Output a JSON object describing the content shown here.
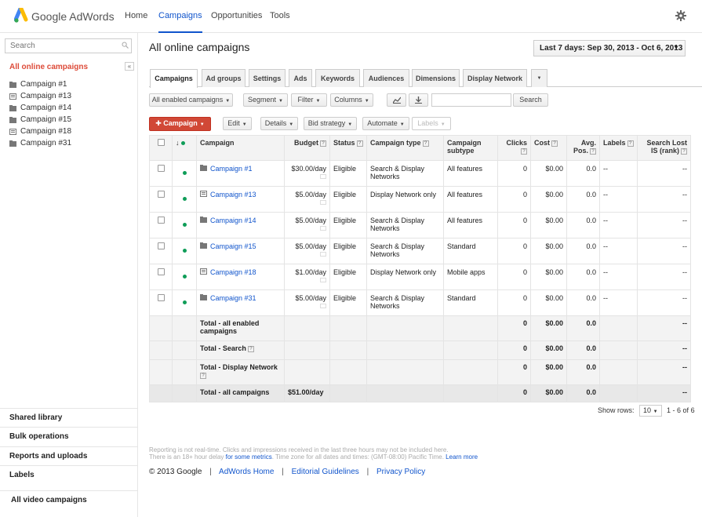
{
  "brand": {
    "name": "Google AdWords"
  },
  "nav": {
    "items": [
      "Home",
      "Campaigns",
      "Opportunities",
      "Tools"
    ],
    "active": "Campaigns"
  },
  "sidebar": {
    "search_placeholder": "Search",
    "collapse_label": "«",
    "all_campaigns_label": "All online campaigns",
    "campaigns": [
      {
        "label": "Campaign #1",
        "icon": "search-campaign-icon"
      },
      {
        "label": "Campaign #13",
        "icon": "display-campaign-icon"
      },
      {
        "label": "Campaign #14",
        "icon": "search-campaign-icon"
      },
      {
        "label": "Campaign #15",
        "icon": "search-campaign-icon"
      },
      {
        "label": "Campaign #18",
        "icon": "display-campaign-icon"
      },
      {
        "label": "Campaign #31",
        "icon": "search-campaign-icon"
      }
    ],
    "sections": [
      "Shared library",
      "Bulk operations",
      "Reports and uploads",
      "Labels",
      "All video campaigns"
    ]
  },
  "main": {
    "title": "All online campaigns",
    "date_range": "Last 7 days: Sep 30, 2013 - Oct 6, 2013",
    "tabs": [
      "Campaigns",
      "Ad groups",
      "Settings",
      "Ads",
      "Keywords",
      "Audiences",
      "Dimensions",
      "Display Network"
    ],
    "active_tab": "Campaigns",
    "toolbar": {
      "filter_all": "All enabled campaigns",
      "segment": "Segment",
      "filter": "Filter",
      "columns": "Columns",
      "search_button": "Search",
      "new_campaign": "Campaign",
      "edit": "Edit",
      "details": "Details",
      "bid_strategy": "Bid strategy",
      "automate": "Automate",
      "labels": "Labels"
    },
    "table": {
      "headers": {
        "campaign": "Campaign",
        "budget": "Budget",
        "status": "Status",
        "campaign_type": "Campaign type",
        "campaign_subtype": "Campaign subtype",
        "clicks": "Clicks",
        "cost": "Cost",
        "avg_pos": "Avg. Pos.",
        "labels": "Labels",
        "search_lost_is": "Search Lost IS (rank)"
      },
      "rows": [
        {
          "name": "Campaign #1",
          "budget": "$30.00/day",
          "status": "Eligible",
          "type": "Search & Display Networks",
          "subtype": "All features",
          "clicks": "0",
          "cost": "$0.00",
          "avg_pos": "0.0",
          "labels": "--",
          "lost_is": "--",
          "icon": "search-campaign-icon"
        },
        {
          "name": "Campaign #13",
          "budget": "$5.00/day",
          "status": "Eligible",
          "type": "Display Network only",
          "subtype": "All features",
          "clicks": "0",
          "cost": "$0.00",
          "avg_pos": "0.0",
          "labels": "--",
          "lost_is": "--",
          "icon": "display-campaign-icon"
        },
        {
          "name": "Campaign #14",
          "budget": "$5.00/day",
          "status": "Eligible",
          "type": "Search & Display Networks",
          "subtype": "All features",
          "clicks": "0",
          "cost": "$0.00",
          "avg_pos": "0.0",
          "labels": "--",
          "lost_is": "--",
          "icon": "search-campaign-icon"
        },
        {
          "name": "Campaign #15",
          "budget": "$5.00/day",
          "status": "Eligible",
          "type": "Search & Display Networks",
          "subtype": "Standard",
          "clicks": "0",
          "cost": "$0.00",
          "avg_pos": "0.0",
          "labels": "--",
          "lost_is": "--",
          "icon": "search-campaign-icon"
        },
        {
          "name": "Campaign #18",
          "budget": "$1.00/day",
          "status": "Eligible",
          "type": "Display Network only",
          "subtype": "Mobile apps",
          "clicks": "0",
          "cost": "$0.00",
          "avg_pos": "0.0",
          "labels": "--",
          "lost_is": "--",
          "icon": "display-campaign-icon"
        },
        {
          "name": "Campaign #31",
          "budget": "$5.00/day",
          "status": "Eligible",
          "type": "Search & Display Networks",
          "subtype": "Standard",
          "clicks": "0",
          "cost": "$0.00",
          "avg_pos": "0.0",
          "labels": "--",
          "lost_is": "--",
          "icon": "search-campaign-icon"
        }
      ],
      "totals": [
        {
          "label": "Total - all enabled campaigns",
          "budget": "",
          "clicks": "0",
          "cost": "$0.00",
          "avg_pos": "0.0",
          "lost_is": "--",
          "help": false
        },
        {
          "label": "Total - Search",
          "budget": "",
          "clicks": "0",
          "cost": "$0.00",
          "avg_pos": "0.0",
          "lost_is": "--",
          "help": true
        },
        {
          "label": "Total - Display Network",
          "budget": "",
          "clicks": "0",
          "cost": "$0.00",
          "avg_pos": "0.0",
          "lost_is": "--",
          "help": true
        },
        {
          "label": "Total - all campaigns",
          "budget": "$51.00/day",
          "clicks": "0",
          "cost": "$0.00",
          "avg_pos": "0.0",
          "lost_is": "--",
          "help": false
        }
      ]
    },
    "pagination": {
      "show_rows_label": "Show rows:",
      "rows_value": "10",
      "range": "1 - 6 of 6"
    },
    "footnote": {
      "line1": "Reporting is not real-time. Clicks and impressions received in the last three hours may not be included here.",
      "line2_pre": "There is an 18+ hour delay ",
      "line2_link": "for some metrics",
      "line2_mid": ". Time zone for all dates and times: (GMT-08:00) Pacific Time. ",
      "line2_link2": "Learn more"
    },
    "footer": {
      "copyright": "© 2013 Google",
      "links": [
        "AdWords Home",
        "Editorial Guidelines",
        "Privacy Policy"
      ]
    }
  },
  "colors": {
    "accent_blue": "#1155cc",
    "brand_red": "#dd4b39",
    "button_red": "#d14836",
    "status_green": "#0f9d58"
  }
}
